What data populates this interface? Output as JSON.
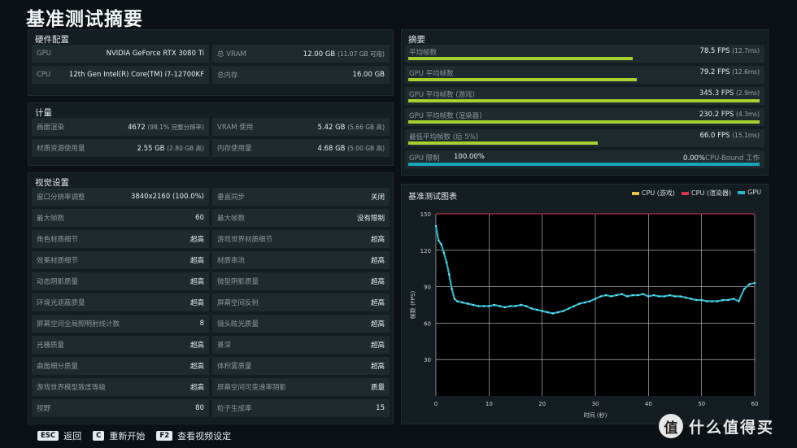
{
  "title": "基准测试摘要",
  "hardware": {
    "title": "硬件配置",
    "rows": [
      [
        {
          "k": "GPU",
          "v": "NVIDIA GeForce RTX 3080 Ti",
          "s": ""
        },
        {
          "k": "总 VRAM",
          "v": "12.00 GB",
          "s": "(11.07 GB 可用)"
        }
      ],
      [
        {
          "k": "CPU",
          "v": "12th Gen Intel(R) Core(TM) i7-12700KF",
          "s": ""
        },
        {
          "k": "总内存",
          "v": "16.00 GB",
          "s": ""
        }
      ]
    ]
  },
  "metrics": {
    "title": "计量",
    "rows": [
      [
        {
          "k": "画面渲染",
          "v": "4672",
          "s": "(98.1% 完整分辨率)"
        },
        {
          "k": "VRAM 使用",
          "v": "5.42 GB",
          "s": "(5.66 GB 高)"
        }
      ],
      [
        {
          "k": "材质资源使用量",
          "v": "2.55 GB",
          "s": "(2.80 GB 高)"
        },
        {
          "k": "内存使用量",
          "v": "4.68 GB",
          "s": "(5.00 GB 高)"
        }
      ]
    ]
  },
  "visual": {
    "title": "视觉设置",
    "rows": [
      [
        {
          "k": "窗口分辨率调整",
          "v": "3840x2160 (100.0%)"
        },
        {
          "k": "垂直同步",
          "v": "关闭"
        }
      ],
      [
        {
          "k": "最大帧数",
          "v": "60"
        },
        {
          "k": "最大帧数",
          "v": "没有限制"
        }
      ],
      [
        {
          "k": "角色材质细节",
          "v": "超高"
        },
        {
          "k": "游戏世界材质细节",
          "v": "超高"
        }
      ],
      [
        {
          "k": "效果材质细节",
          "v": "超高"
        },
        {
          "k": "材质串流",
          "v": "超高"
        }
      ],
      [
        {
          "k": "动态阴影质量",
          "v": "超高"
        },
        {
          "k": "微型阴影质量",
          "v": "超高"
        }
      ],
      [
        {
          "k": "环境光遮蔽质量",
          "v": "超高"
        },
        {
          "k": "屏幕空间反射",
          "v": "超高"
        }
      ],
      [
        {
          "k": "屏幕空间全局照明射线计数",
          "v": "8"
        },
        {
          "k": "镜头眩光质量",
          "v": "超高"
        }
      ],
      [
        {
          "k": "光栅质量",
          "v": "超高"
        },
        {
          "k": "景深",
          "v": "超高"
        }
      ],
      [
        {
          "k": "曲面细分质量",
          "v": "超高"
        },
        {
          "k": "体积雾质量",
          "v": "超高"
        }
      ],
      [
        {
          "k": "游戏世界模型致度等级",
          "v": "超高"
        },
        {
          "k": "屏幕空间可变速率阴影",
          "v": "质量"
        }
      ],
      [
        {
          "k": "视野",
          "v": "80"
        },
        {
          "k": "粒子生成率",
          "v": "15"
        }
      ]
    ]
  },
  "summary": {
    "title": "摘要",
    "rows": [
      {
        "k": "平均帧数",
        "v": "78.5 FPS",
        "s": "(12.7ms)",
        "fill": 0.64,
        "color": "#a6d12f"
      },
      {
        "k": "GPU 平均帧数",
        "v": "79.2 FPS",
        "s": "(12.6ms)",
        "fill": 0.65,
        "color": "#a6d12f"
      },
      {
        "k": "GPU 平均帧数 (游戏)",
        "v": "345.3 FPS",
        "s": "(2.9ms)",
        "fill": 1.0,
        "color": "#a6d12f"
      },
      {
        "k": "GPU 平均帧数 (渲染器)",
        "v": "230.2 FPS",
        "s": "(4.3ms)",
        "fill": 1.0,
        "color": "#a6d12f"
      },
      {
        "k": "最低平均帧数 (后 5%)",
        "v": "66.0 FPS",
        "s": "(15.1ms)",
        "fill": 0.54,
        "color": "#a6d12f"
      }
    ],
    "gpu_limit": {
      "k": "GPU 限制",
      "left": "100.00%",
      "right": "0.00%",
      "right_label": "CPU-Bound 工作",
      "fill": 1.0,
      "color": "#19a5b8"
    }
  },
  "chart_panel_title": "基准测试图表",
  "chart_data": {
    "type": "line",
    "xlabel": "时间 (秒)",
    "ylabel": "帧数 (FPS)",
    "xlim": [
      0,
      60
    ],
    "ylim": [
      0,
      150
    ],
    "xticks": [
      0,
      10,
      20,
      30,
      40,
      50,
      60
    ],
    "yticks": [
      30,
      60,
      90,
      120,
      150
    ],
    "grid": true,
    "legend_position": "top-right",
    "series": [
      {
        "name": "CPU (游戏)",
        "color": "#e8c34a",
        "x": [],
        "y": []
      },
      {
        "name": "CPU (渲染器)",
        "color": "#d8334a",
        "x": [
          0,
          60
        ],
        "y": [
          150,
          150
        ]
      },
      {
        "name": "GPU",
        "color": "#27b5c7",
        "x": [
          0,
          0.5,
          1,
          1.5,
          2,
          2.5,
          3,
          3.5,
          4,
          5,
          6,
          7,
          8,
          9,
          10,
          11,
          12,
          13,
          14,
          15,
          16,
          17,
          18,
          19,
          20,
          21,
          22,
          23,
          24,
          25,
          26,
          27,
          28,
          29,
          30,
          31,
          32,
          33,
          34,
          35,
          36,
          37,
          38,
          39,
          40,
          41,
          42,
          43,
          44,
          45,
          46,
          47,
          48,
          49,
          50,
          51,
          52,
          53,
          54,
          55,
          56,
          57,
          58,
          59,
          60
        ],
        "y": [
          140,
          128,
          125,
          118,
          110,
          100,
          88,
          80,
          78,
          77,
          76,
          75,
          74,
          74,
          74,
          75,
          74,
          73,
          74,
          74,
          75,
          74,
          72,
          71,
          70,
          69,
          68,
          69,
          70,
          72,
          74,
          76,
          77,
          78,
          80,
          82,
          83,
          82,
          83,
          84,
          82,
          83,
          83,
          84,
          82,
          83,
          82,
          82,
          83,
          82,
          82,
          81,
          80,
          79,
          79,
          78,
          78,
          78,
          79,
          79,
          80,
          78,
          88,
          92,
          93
        ]
      }
    ]
  },
  "footer": [
    {
      "key": "ESC",
      "label": "返回"
    },
    {
      "key": "C",
      "label": "重新开始"
    },
    {
      "key": "F2",
      "label": "查看视频设定"
    }
  ],
  "logo": {
    "mark": "值",
    "text": "什么值得买"
  }
}
